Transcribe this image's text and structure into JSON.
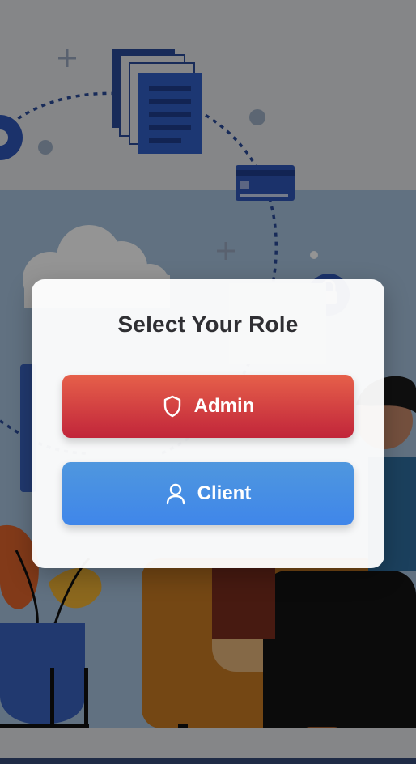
{
  "modal": {
    "title": "Select Your Role",
    "buttons": [
      {
        "label": "Admin",
        "icon": "shield-icon",
        "color_top": "#e6604a",
        "color_bottom": "#c1253a"
      },
      {
        "label": "Client",
        "icon": "user-icon",
        "color_top": "#4f97de",
        "color_bottom": "#3f86ea"
      }
    ]
  },
  "background": {
    "description_icons": [
      "documents-icon",
      "credit-card-icon",
      "lock-icon",
      "gear-icon",
      "cloud-icon",
      "plant-icon"
    ],
    "overlay_color": "rgba(0,0,0,0.42)"
  }
}
